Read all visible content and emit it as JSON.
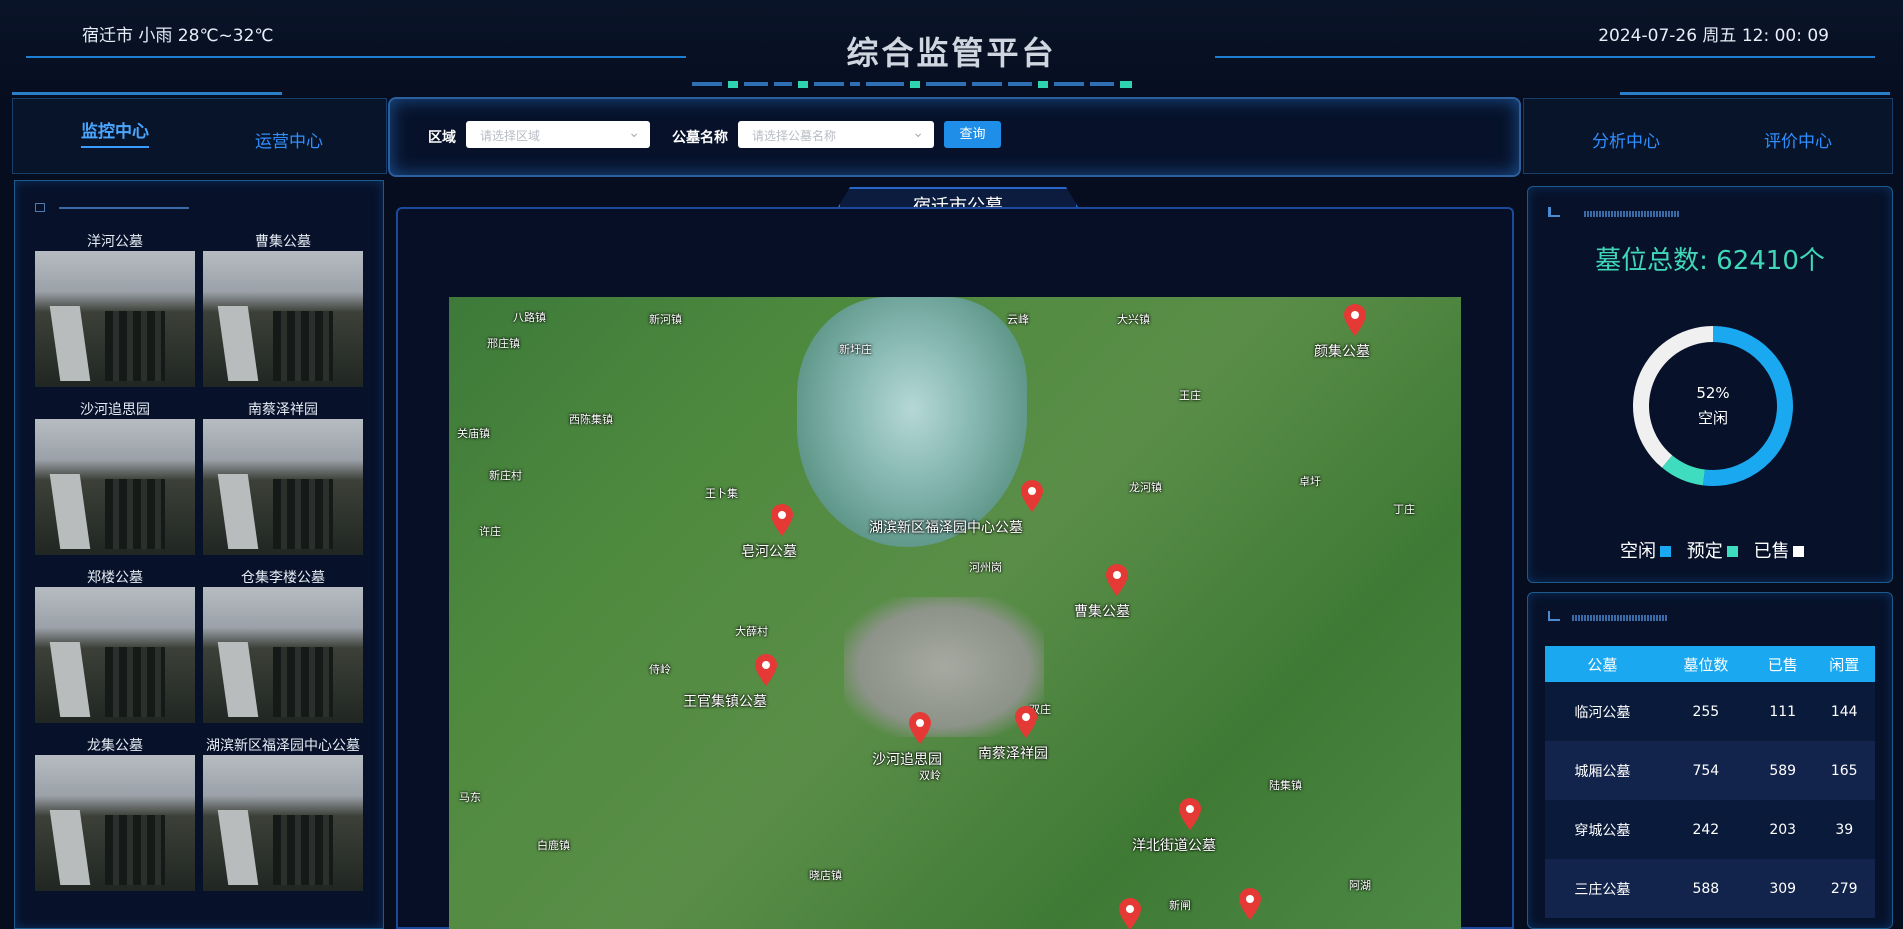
{
  "header": {
    "weather": "宿迁市 小雨 28℃~32℃",
    "title": "综合监管平台",
    "datetime": "2024-07-26 周五 12: 00: 09"
  },
  "nav": {
    "left_tabs": [
      {
        "label": "监控中心",
        "active": true
      },
      {
        "label": "运营中心",
        "active": false
      }
    ],
    "right_tabs": [
      {
        "label": "分析中心"
      },
      {
        "label": "评价中心"
      }
    ]
  },
  "search": {
    "region_label": "区域",
    "region_placeholder": "请选择区域",
    "cemetery_label": "公墓名称",
    "cemetery_placeholder": "请选择公墓名称",
    "query_label": "查询"
  },
  "cameras": [
    {
      "name": "洋河公墓"
    },
    {
      "name": "曹集公墓"
    },
    {
      "name": "沙河追思园"
    },
    {
      "name": "南蔡泽祥园"
    },
    {
      "name": "郑楼公墓"
    },
    {
      "name": "仓集李楼公墓"
    },
    {
      "name": "龙集公墓"
    },
    {
      "name": "湖滨新区福泽园中心公墓"
    }
  ],
  "map": {
    "title": "宿迁市公墓",
    "pins": [
      {
        "label": "颜集公墓"
      },
      {
        "label": "皂河公墓"
      },
      {
        "label": "湖滨新区福泽园中心公墓"
      },
      {
        "label": "曹集公墓"
      },
      {
        "label": "王官集镇公墓"
      },
      {
        "label": "沙河追思园"
      },
      {
        "label": "南蔡泽祥园"
      },
      {
        "label": "洋北街道公墓"
      },
      {
        "label": ""
      },
      {
        "label": ""
      }
    ],
    "places": [
      "八路镇",
      "新河镇",
      "云峰",
      "大兴镇",
      "邢庄镇",
      "新圩庄",
      "王庄",
      "西陈集镇",
      "关庙镇",
      "新庄村",
      "王卜集",
      "许庄",
      "河州岗",
      "大薛村",
      "侍岭",
      "卓圩",
      "龙河镇",
      "丁庄",
      "双庄",
      "陆集镇",
      "白鹿镇",
      "晓店镇",
      "新闸",
      "阿湖",
      "马东",
      "双岭"
    ]
  },
  "stats": {
    "total": "墓位总数: 62410个",
    "donut_center_pct": "52%",
    "donut_center_label": "空闲",
    "legend": [
      {
        "label": "空闲",
        "color": "#1aa8f0"
      },
      {
        "label": "预定",
        "color": "#3fdcc0"
      },
      {
        "label": "已售",
        "color": "#ffffff"
      }
    ],
    "donut": [
      {
        "name": "空闲",
        "value": 52,
        "color": "#1aa8f0"
      },
      {
        "name": "预定",
        "value": 9,
        "color": "#3fdcc0"
      },
      {
        "name": "已售",
        "value": 39,
        "color": "#f0f0f0"
      }
    ]
  },
  "table": {
    "headers": [
      "公墓",
      "墓位数",
      "已售",
      "闲置"
    ],
    "rows": [
      [
        "临河公墓",
        "255",
        "111",
        "144"
      ],
      [
        "城厢公墓",
        "754",
        "589",
        "165"
      ],
      [
        "穿城公墓",
        "242",
        "203",
        "39"
      ],
      [
        "三庄公墓",
        "588",
        "309",
        "279"
      ]
    ]
  }
}
